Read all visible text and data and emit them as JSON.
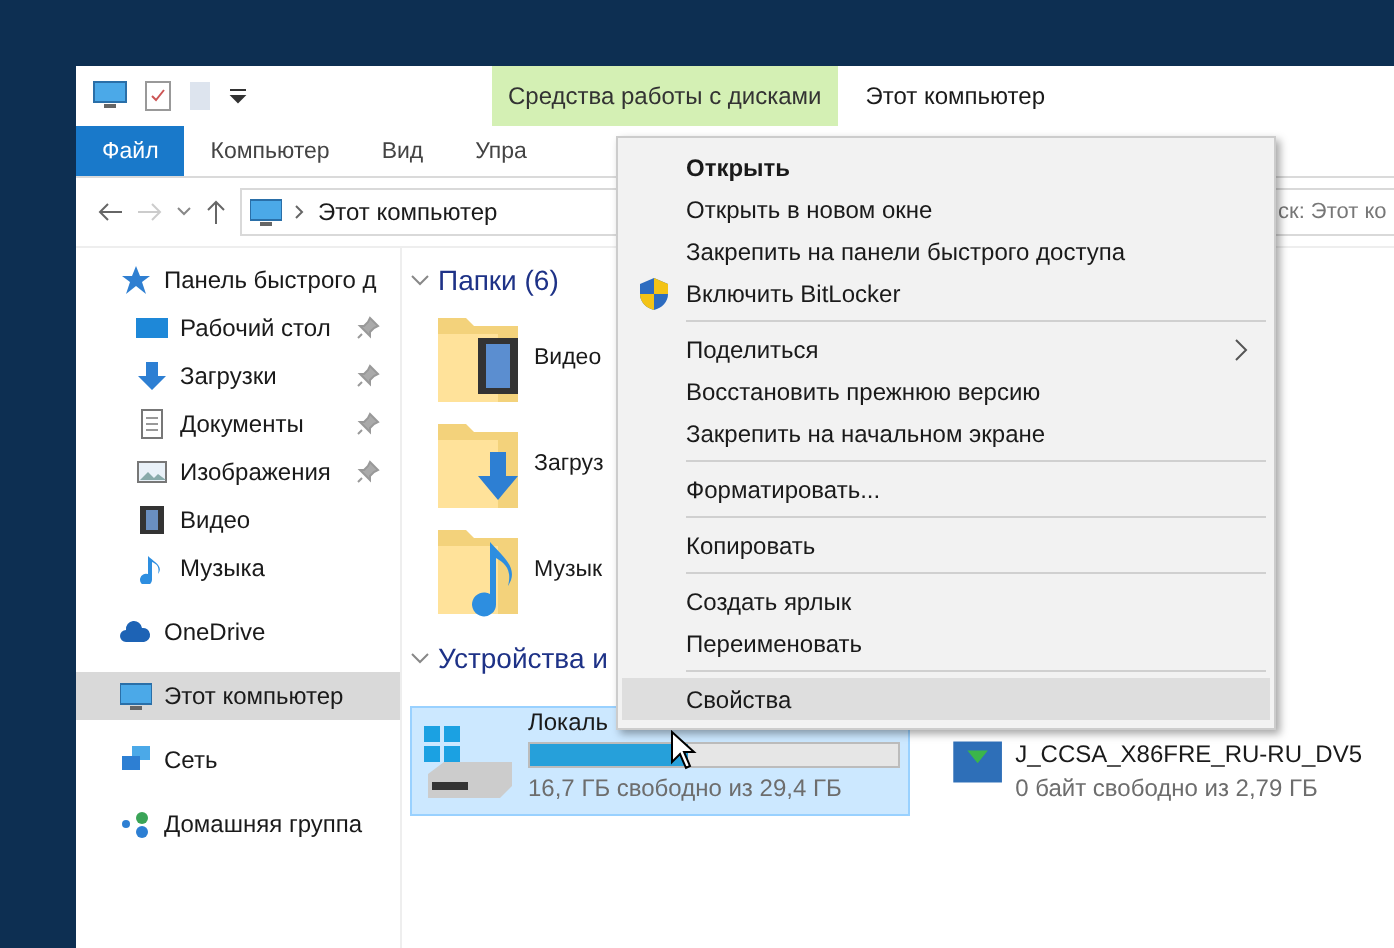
{
  "titlebar": {
    "contextual_tab": "Средства работы с дисками",
    "title": "Этот компьютер"
  },
  "ribbon_tabs": [
    {
      "label": "Файл",
      "selected": true
    },
    {
      "label": "Компьютер",
      "selected": false
    },
    {
      "label": "Вид",
      "selected": false
    },
    {
      "label": "Упра",
      "selected": false
    }
  ],
  "address": {
    "path": "Этот компьютер",
    "search_placeholder": "ск: Этот ко"
  },
  "sidebar": {
    "items": [
      {
        "label": "Панель быстрого д",
        "kind": "star",
        "selected": false,
        "children": [
          {
            "label": "Рабочий стол",
            "kind": "desktop",
            "pinned": true
          },
          {
            "label": "Загрузки",
            "kind": "download",
            "pinned": true
          },
          {
            "label": "Документы",
            "kind": "document",
            "pinned": true
          },
          {
            "label": "Изображения",
            "kind": "picture",
            "pinned": true
          },
          {
            "label": "Видео",
            "kind": "video",
            "pinned": false
          },
          {
            "label": "Музыка",
            "kind": "music",
            "pinned": false
          }
        ]
      },
      {
        "label": "OneDrive",
        "kind": "cloud",
        "selected": false
      },
      {
        "label": "Этот компьютер",
        "kind": "computer",
        "selected": true
      },
      {
        "label": "Сеть",
        "kind": "network",
        "selected": false
      },
      {
        "label": "Домашняя группа",
        "kind": "homegroup",
        "selected": false
      }
    ]
  },
  "folders": {
    "header": "Папки (6)",
    "items": [
      {
        "name": "Видео",
        "kind": "video"
      },
      {
        "name": "Загруз",
        "kind": "download"
      },
      {
        "name": "Музык",
        "kind": "music"
      }
    ]
  },
  "devices": {
    "header": "Устройства и",
    "items": [
      {
        "name": "Локаль",
        "kind": "windows",
        "selected": true,
        "level": 0.43,
        "free": "16,7 ГБ свободно из 29,4 ГБ"
      },
      {
        "name": "J_CCSA_X86FRE_RU-RU_DV5",
        "kind": "disc",
        "selected": false,
        "free": "0 байт свободно из 2,79 ГБ"
      }
    ]
  },
  "context_menu": {
    "groups": [
      [
        {
          "label": "Открыть",
          "default": true,
          "has_icon": false,
          "submenu": false,
          "selected": false
        },
        {
          "label": "Открыть в новом окне",
          "default": false,
          "has_icon": false,
          "submenu": false,
          "selected": false
        },
        {
          "label": "Закрепить на панели быстрого доступа",
          "default": false,
          "has_icon": false,
          "submenu": false,
          "selected": false
        },
        {
          "label": "Включить BitLocker",
          "default": false,
          "has_icon": true,
          "submenu": false,
          "selected": false
        }
      ],
      [
        {
          "label": "Поделиться",
          "default": false,
          "has_icon": false,
          "submenu": true,
          "selected": false
        },
        {
          "label": "Восстановить прежнюю версию",
          "default": false,
          "has_icon": false,
          "submenu": false,
          "selected": false
        },
        {
          "label": "Закрепить на начальном экране",
          "default": false,
          "has_icon": false,
          "submenu": false,
          "selected": false
        }
      ],
      [
        {
          "label": "Форматировать...",
          "default": false,
          "has_icon": false,
          "submenu": false,
          "selected": false
        }
      ],
      [
        {
          "label": "Копировать",
          "default": false,
          "has_icon": false,
          "submenu": false,
          "selected": false
        }
      ],
      [
        {
          "label": "Создать ярлык",
          "default": false,
          "has_icon": false,
          "submenu": false,
          "selected": false
        },
        {
          "label": "Переименовать",
          "default": false,
          "has_icon": false,
          "submenu": false,
          "selected": false
        }
      ],
      [
        {
          "label": "Свойства",
          "default": false,
          "has_icon": false,
          "submenu": false,
          "selected": true
        }
      ]
    ]
  }
}
